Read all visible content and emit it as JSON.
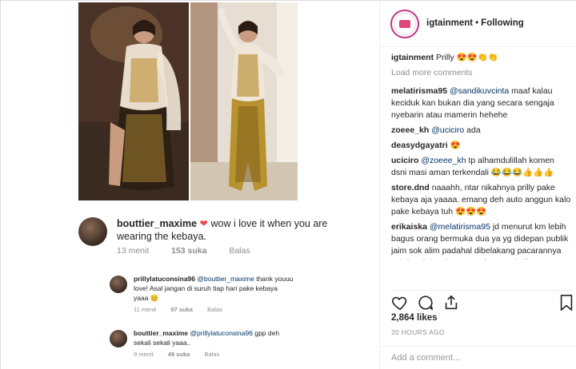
{
  "header": {
    "username": "igtainment",
    "separator": "•",
    "follow_status": "Following"
  },
  "caption": {
    "username": "igtainment",
    "text": "Prilly 😍😍👏👏"
  },
  "load_more": "Load more comments",
  "comments": [
    {
      "username": "melatirisma95",
      "mention": "@sandikuvcinta",
      "text": " maaf kalau keciduk kan bukan dia yang secara sengaja nyebarin atau mamerin hehehe"
    },
    {
      "username": "zoeee_kh",
      "mention": "@uciciro",
      "text": " ada"
    },
    {
      "username": "deasydgayatri",
      "mention": "",
      "text": " 😍"
    },
    {
      "username": "uciciro",
      "mention": "@zoeee_kh",
      "text": " tp alhamdulillah komen dsni masi aman terkendali 😂😂😂👍👍👍"
    },
    {
      "username": "store.dnd",
      "mention": "",
      "text": " naaahh, ntar nikahnya prilly pake kebaya aja yaaaa. emang deh auto anggun kalo pake kebaya tuh 😍😍😍"
    },
    {
      "username": "erikaiska",
      "mention": "@melatirisma95",
      "text": " jd menurut km lebih bagus orang bermuka dua ya yg didepan publik jaim sok alim padahal dibelakang pacarannya peluk pelukan jg. Terserah orang kali mau gaya pacaran kayak gimana. Setiap orang itu punya gaya"
    }
  ],
  "likes": "2,864 likes",
  "time_ago": "20 HOURS AGO",
  "add_comment_placeholder": "Add a comment...",
  "embedded": {
    "main_comment": {
      "username": "bouttier_maxime",
      "text": " wow i love it when you are wearing the kebaya.",
      "time": "13 menit",
      "likes": "153 suka",
      "reply": "Balas"
    },
    "reply1": {
      "username": "prillylatuconsina96",
      "mention": "@bouttier_maxime",
      "text": " thank youuu love! Asal jangan di suruh tiap hari pake kebaya yaaa 😊",
      "time": "11 menit",
      "likes": "97 suka",
      "reply": "Balas"
    },
    "reply2": {
      "username": "bouttier_maxime",
      "mention": "@prillylatuconsina96",
      "text": " gpp deh sekali sekali yaaa..",
      "time": "9 menit",
      "likes": "49 suka",
      "reply": "Balas"
    }
  },
  "colors": {
    "brand_ring": "#c13584",
    "heart": "#ed4956",
    "muted": "#8e8e8e",
    "mention": "#003569"
  }
}
